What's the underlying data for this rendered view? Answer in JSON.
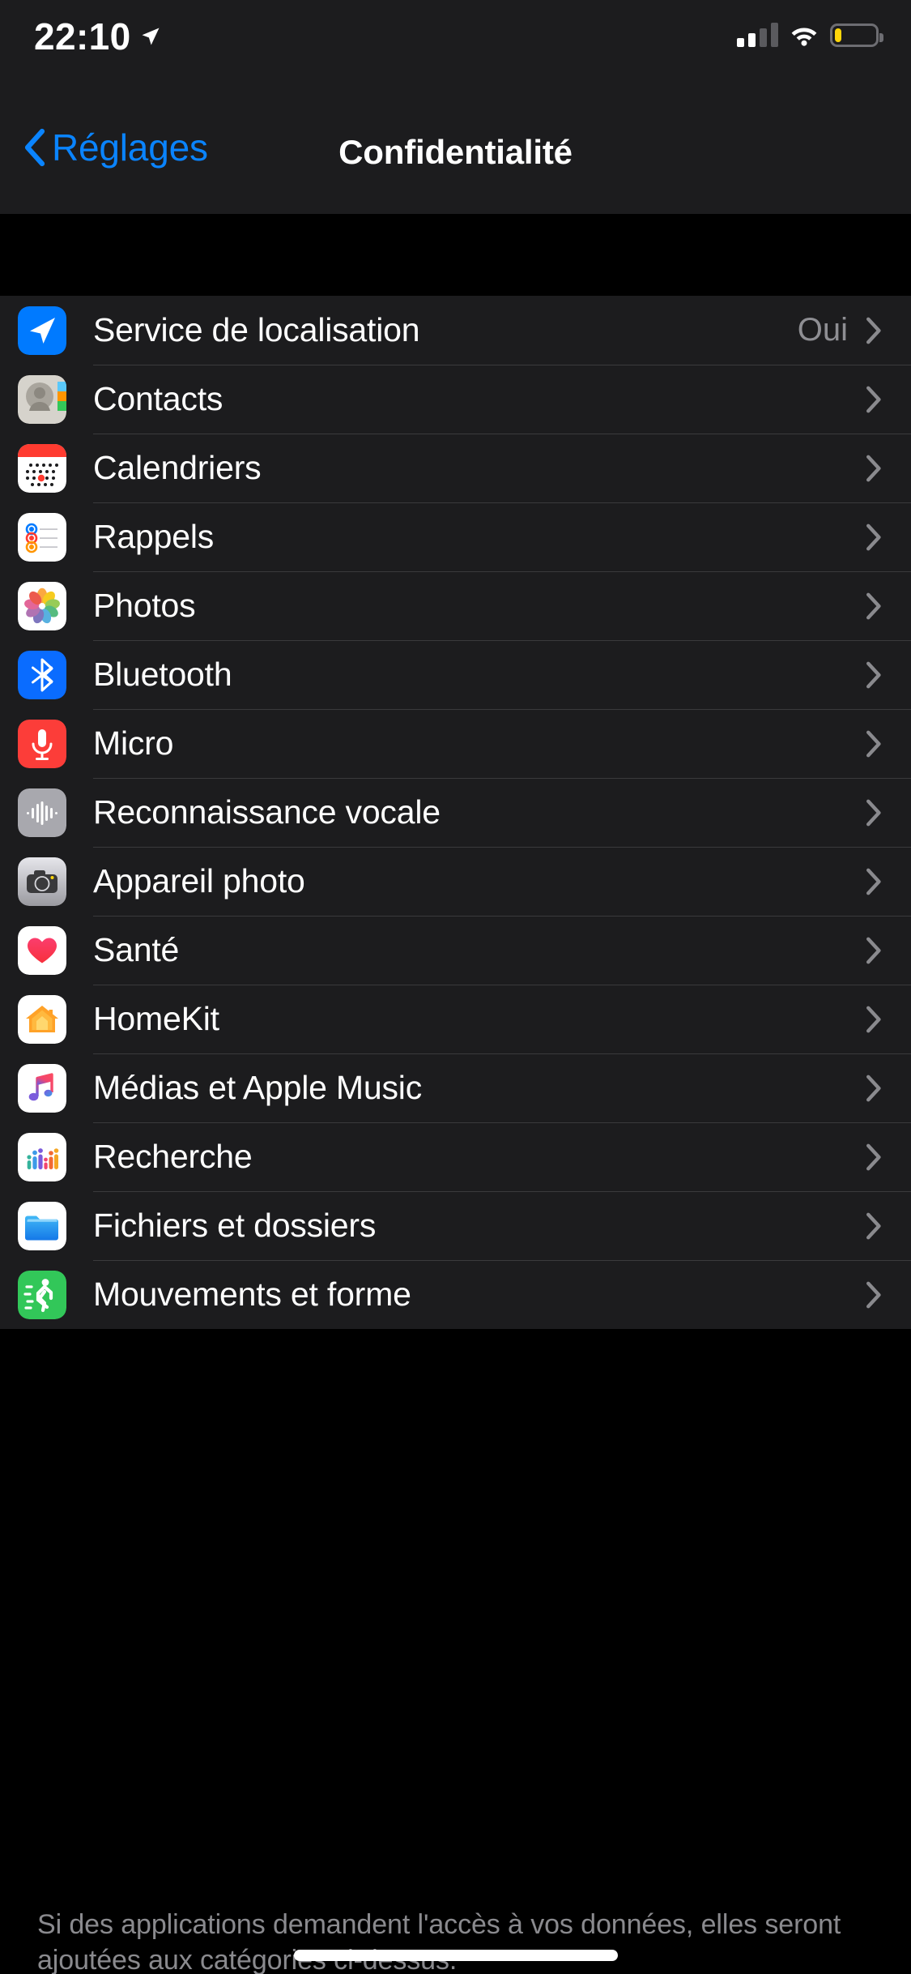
{
  "status_bar": {
    "time": "22:10",
    "location_icon": "location-arrow-icon",
    "cellular_icon": "cellular-signal-icon",
    "cellular_bars_filled": 2,
    "cellular_bars_total": 4,
    "wifi_icon": "wifi-icon",
    "battery_icon": "battery-icon",
    "battery_level_percent": 15,
    "battery_color": "#ffd60a"
  },
  "nav": {
    "back_label": "Réglages",
    "back_icon": "chevron-left-icon",
    "title": "Confidentialité",
    "accent_color": "#0a84ff"
  },
  "list": {
    "rows": [
      {
        "label": "Service de localisation",
        "value": "Oui",
        "icon": "location-services-icon"
      },
      {
        "label": "Contacts",
        "value": "",
        "icon": "contacts-icon"
      },
      {
        "label": "Calendriers",
        "value": "",
        "icon": "calendar-icon"
      },
      {
        "label": "Rappels",
        "value": "",
        "icon": "reminders-icon"
      },
      {
        "label": "Photos",
        "value": "",
        "icon": "photos-icon"
      },
      {
        "label": "Bluetooth",
        "value": "",
        "icon": "bluetooth-icon"
      },
      {
        "label": "Micro",
        "value": "",
        "icon": "microphone-icon"
      },
      {
        "label": "Reconnaissance vocale",
        "value": "",
        "icon": "speech-recognition-icon"
      },
      {
        "label": "Appareil photo",
        "value": "",
        "icon": "camera-icon"
      },
      {
        "label": "Santé",
        "value": "",
        "icon": "health-icon"
      },
      {
        "label": "HomeKit",
        "value": "",
        "icon": "homekit-icon"
      },
      {
        "label": "Médias et Apple Music",
        "value": "",
        "icon": "apple-music-icon"
      },
      {
        "label": "Recherche",
        "value": "",
        "icon": "research-icon"
      },
      {
        "label": "Fichiers et dossiers",
        "value": "",
        "icon": "files-icon"
      },
      {
        "label": "Mouvements et forme",
        "value": "",
        "icon": "motion-fitness-icon"
      }
    ],
    "chevron_icon": "chevron-right-icon"
  },
  "footer": {
    "text": "Si des applications demandent l'accès à vos données, elles seront ajoutées aux catégories ci-dessus."
  },
  "colors": {
    "background": "#000000",
    "surface": "#1c1c1e",
    "separator": "#3a3a3c",
    "secondary_text": "#8e8e93",
    "accent": "#0a84ff"
  }
}
